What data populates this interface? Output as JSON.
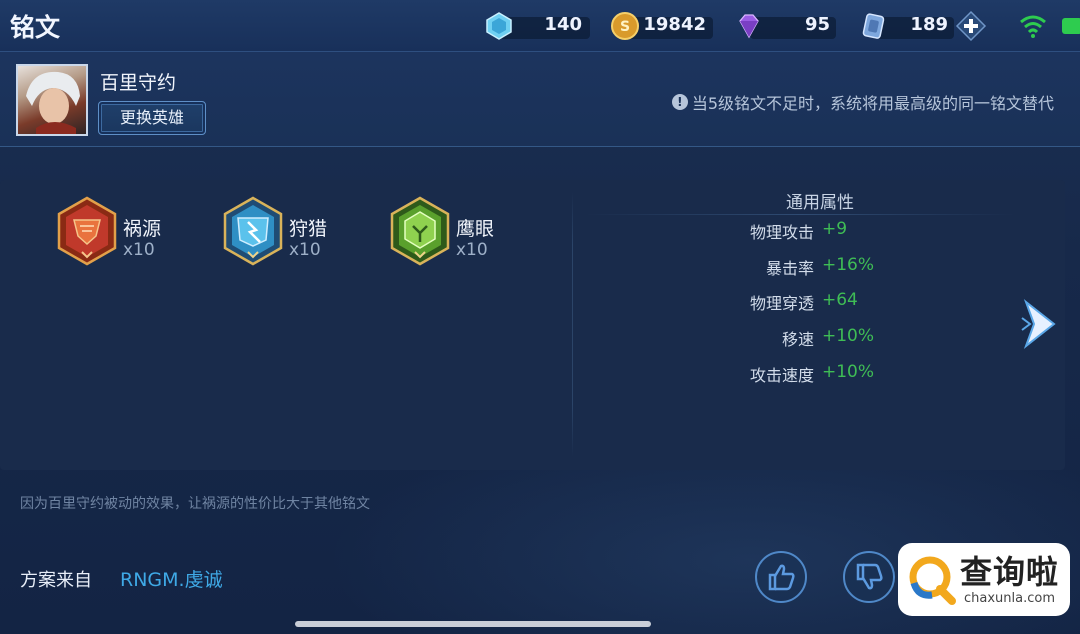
{
  "header": {
    "title": "铭文",
    "resources": [
      {
        "icon": "blue-crystal-icon",
        "value": "140"
      },
      {
        "icon": "gold-coin-icon",
        "value": "19842"
      },
      {
        "icon": "purple-diamond-icon",
        "value": "95"
      },
      {
        "icon": "inscription-fragment-icon",
        "value": "189"
      }
    ],
    "add_icon": "plus-icon",
    "status_icons": [
      "wifi-icon",
      "battery-icon"
    ]
  },
  "hero": {
    "name": "百里守约",
    "change_button": "更换英雄",
    "notice": "当5级铭文不足时，系统将用最高级的同一铭文替代",
    "notice_icon": "info-icon"
  },
  "inscriptions": [
    {
      "name": "祸源",
      "count": "x10",
      "color": "#c0392b"
    },
    {
      "name": "狩猎",
      "count": "x10",
      "color": "#2f8fc4"
    },
    {
      "name": "鹰眼",
      "count": "x10",
      "color": "#5aa02c"
    }
  ],
  "attributes": {
    "title": "通用属性",
    "items": [
      {
        "label": "物理攻击",
        "value": "+9"
      },
      {
        "label": "暴击率",
        "value": "+16%"
      },
      {
        "label": "物理穿透",
        "value": "+64"
      },
      {
        "label": "移速",
        "value": "+10%"
      },
      {
        "label": "攻击速度",
        "value": "+10%"
      }
    ],
    "value_color": "#3fbd55"
  },
  "explanation": "因为百里守约被动的效果，让祸源的性价比大于其他铭文",
  "source": {
    "label": "方案来自",
    "author": "RNGM.虔诚"
  },
  "actions": [
    "thumbs-up-icon",
    "thumbs-down-icon"
  ],
  "watermark": {
    "text": "查询啦",
    "url": "chaxunla.com"
  }
}
